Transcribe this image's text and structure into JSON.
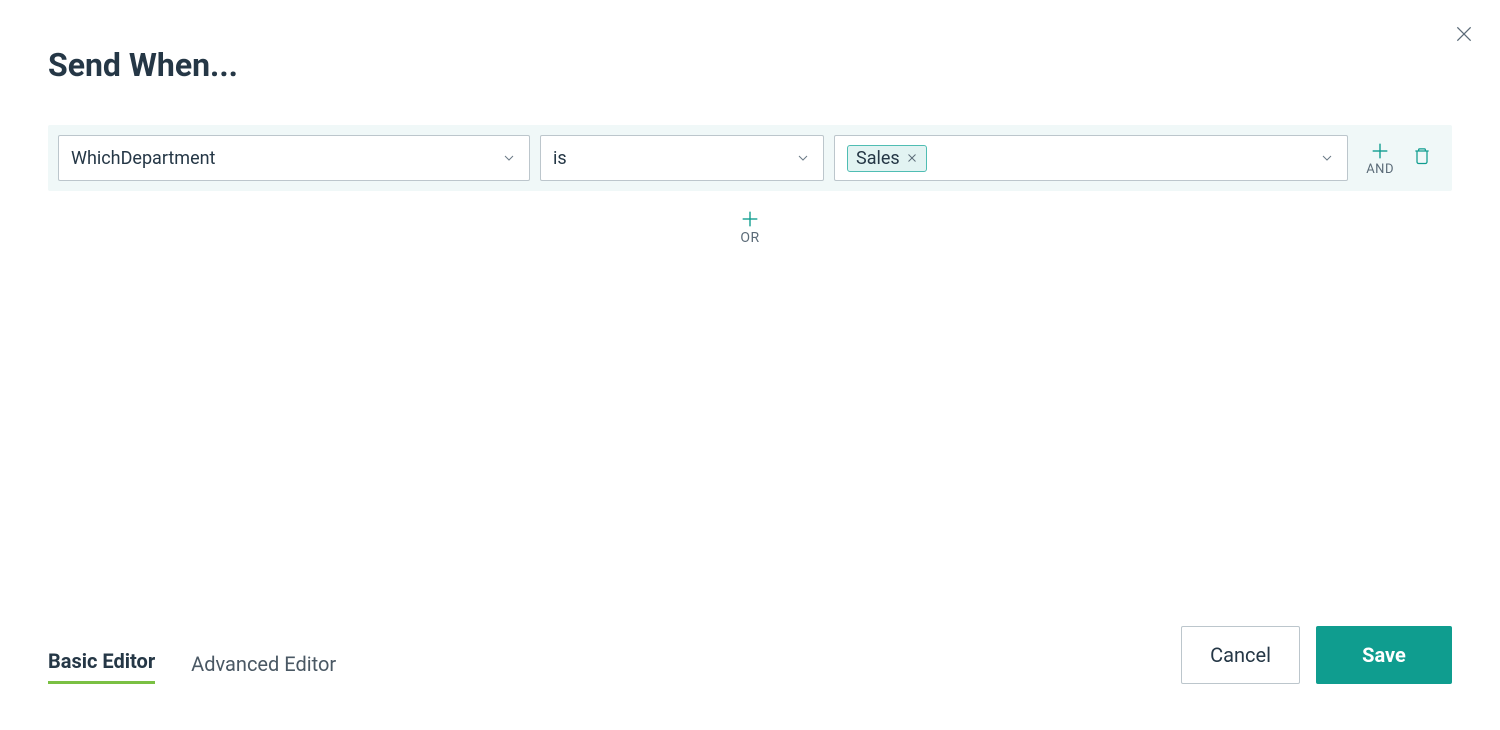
{
  "title": "Send When...",
  "rule": {
    "field": "WhichDepartment",
    "operator": "is",
    "value_chip": "Sales",
    "and_label": "AND"
  },
  "or_label": "OR",
  "tabs": {
    "basic": "Basic Editor",
    "advanced": "Advanced Editor"
  },
  "buttons": {
    "cancel": "Cancel",
    "save": "Save"
  }
}
